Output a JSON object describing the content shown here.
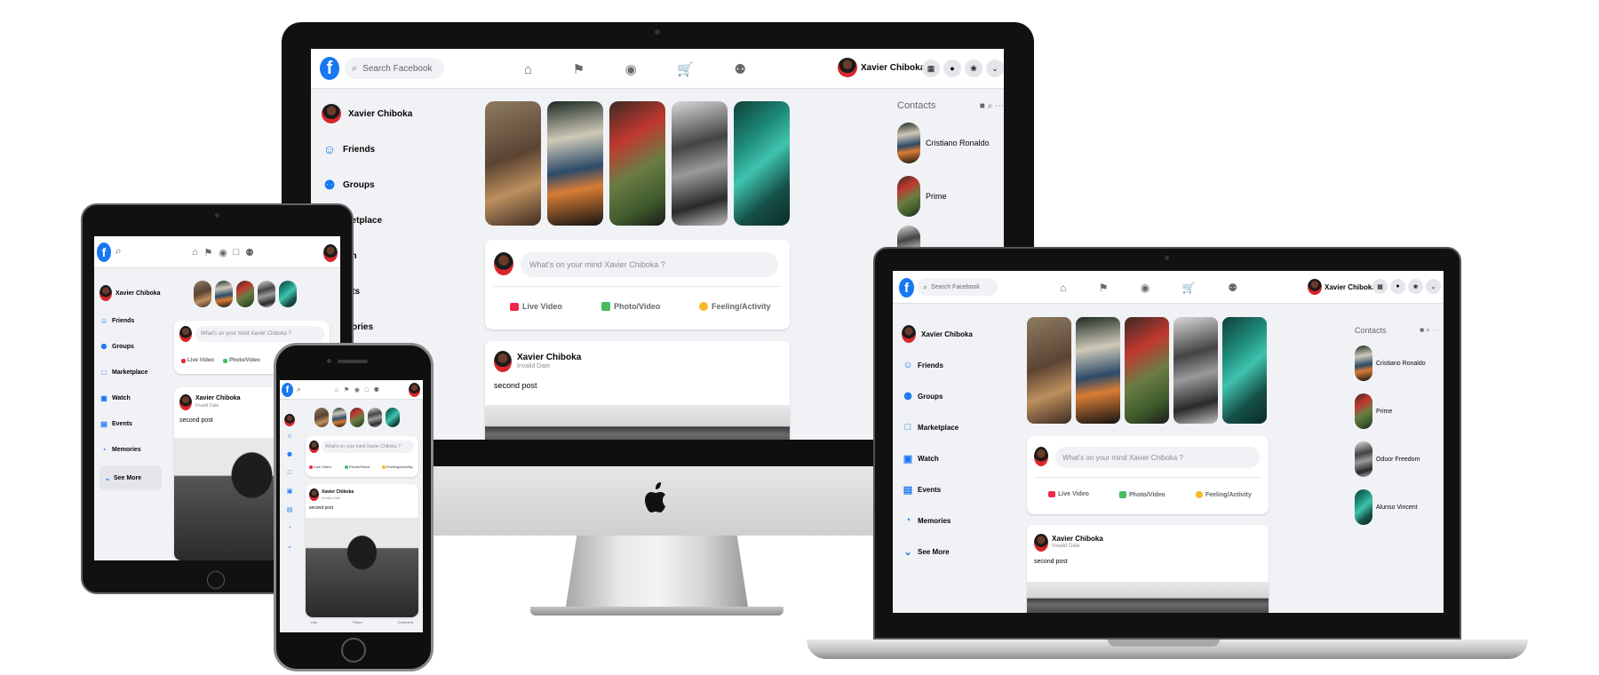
{
  "user": {
    "name": "Xavier Chiboka"
  },
  "search": {
    "placeholder": "Search Facebook"
  },
  "sidebar": {
    "items": [
      {
        "label": "Friends",
        "icon": "friends-icon"
      },
      {
        "label": "Groups",
        "icon": "groups-icon"
      },
      {
        "label": "Marketplace",
        "icon": "marketplace-icon"
      },
      {
        "label": "Watch",
        "icon": "watch-icon"
      },
      {
        "label": "Events",
        "icon": "events-icon"
      },
      {
        "label": "Memories",
        "icon": "memories-icon"
      }
    ],
    "see_more": "See More"
  },
  "desktop_sidebar_visible": [
    "Friends",
    "Groups",
    "ketplace",
    "ch",
    "nts",
    "nories"
  ],
  "composer": {
    "placeholder": "What's on your mind Xavier Chiboka ?",
    "live": "Live Video",
    "photo": "Photo/Video",
    "feeling": "Feeling/Activity"
  },
  "post": {
    "author": "Xavier Chiboka",
    "date": "Invalid Date",
    "text": "second post"
  },
  "contacts": {
    "title": "Contacts",
    "list": [
      "Cristiano Ronaldo",
      "Prime",
      "Oduor Freedom",
      "Alunso Vincent"
    ]
  },
  "phone_bottom": [
    "Like",
    "Share",
    "Comment"
  ],
  "colors": {
    "brand": "#1877f2",
    "live": "#f02849",
    "photo": "#45bd62",
    "feeling": "#f7b928"
  }
}
